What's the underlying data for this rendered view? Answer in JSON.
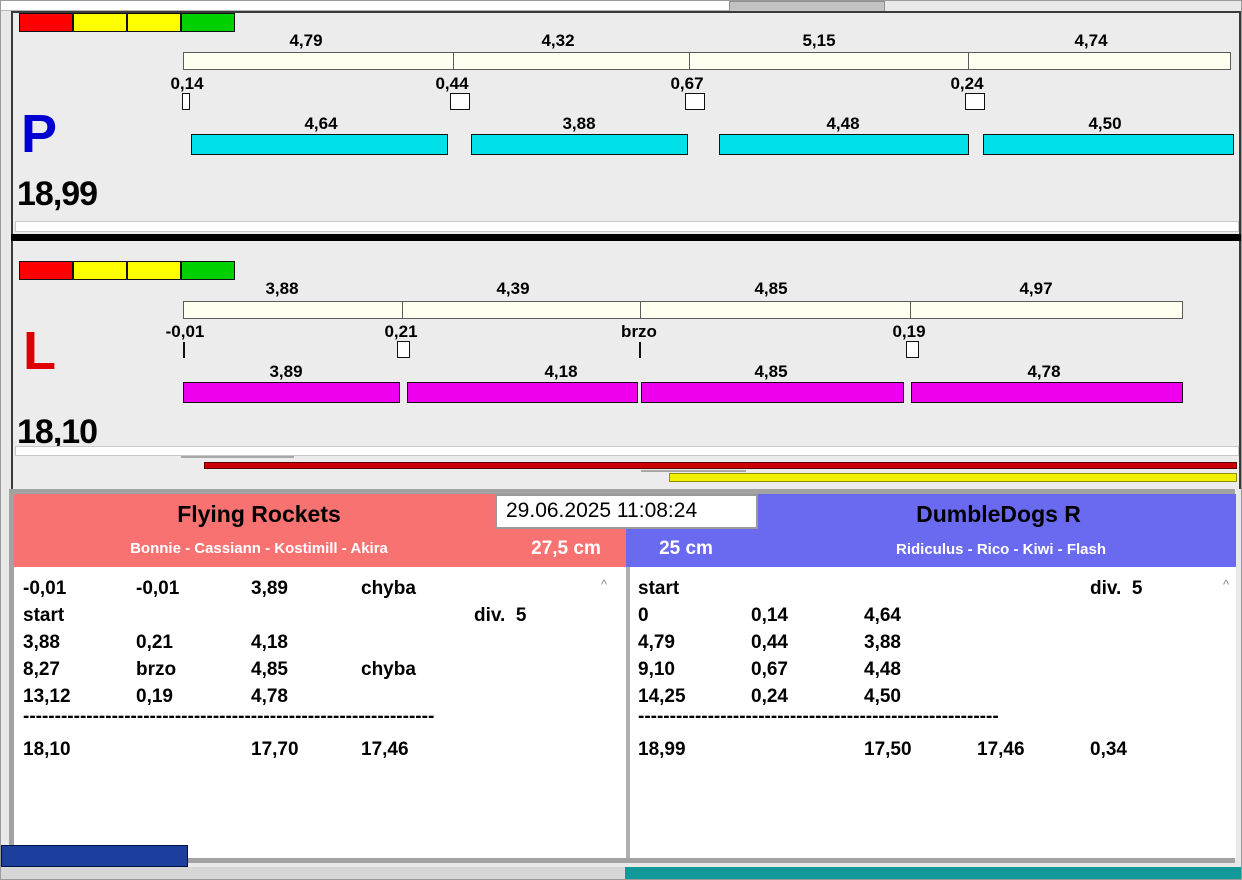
{
  "header": {
    "timestamp": "29.06.2025 11:08:24"
  },
  "colors": {
    "p_letter": "#0000d0",
    "l_letter": "#e00000",
    "p_bar": "#00e0e8",
    "l_bar": "#ee00ee",
    "light_red": "#ff0000",
    "light_yellow": "#ffff00",
    "light_green": "#00d000",
    "left_header": "#f87272",
    "right_header": "#6a6af0",
    "bottom_taskbar": "#129898"
  },
  "lanes": [
    {
      "letter": "P",
      "total": "18,99",
      "splits": [
        "4,79",
        "4,32",
        "5,15",
        "4,74"
      ],
      "changes": [
        "0,14",
        "0,44",
        "0,67",
        "0,24"
      ],
      "legs": [
        "4,64",
        "3,88",
        "4,48",
        "4,50"
      ],
      "lights": [
        "red",
        "yellow",
        "yellow",
        "green"
      ]
    },
    {
      "letter": "L",
      "total": "18,10",
      "splits": [
        "3,88",
        "4,39",
        "4,85",
        "4,97"
      ],
      "changes": [
        "-0,01",
        "0,21",
        "brzo",
        "0,19"
      ],
      "legs": [
        "3,89",
        "4,18",
        "4,85",
        "4,78"
      ],
      "lights": [
        "red",
        "yellow",
        "yellow",
        "green"
      ]
    }
  ],
  "teams": {
    "left": {
      "name": "Flying Rockets",
      "dogs": "Bonnie - Cassiann - Kostimill - Akira",
      "size": "27,5 cm",
      "rows": [
        [
          "-0,01",
          "-0,01",
          "3,89",
          "chyba",
          ""
        ],
        [
          "start",
          "",
          "",
          "",
          "div.  5"
        ],
        [
          "3,88",
          "0,21",
          "4,18",
          "",
          ""
        ],
        [
          "8,27",
          "brzo",
          "4,85",
          "chyba",
          ""
        ],
        [
          "13,12",
          "0,19",
          "4,78",
          "",
          ""
        ]
      ],
      "separator": "-----------------------------------------------------------------",
      "totals": [
        "18,10",
        "",
        "17,70",
        "17,46",
        ""
      ]
    },
    "right": {
      "name": "DumbleDogs R",
      "dogs": "Ridiculus - Rico - Kiwi - Flash",
      "size": "25 cm",
      "rows": [
        [
          "start",
          "",
          "",
          "",
          "div.  5"
        ],
        [
          "0",
          "0,14",
          "4,64",
          "",
          ""
        ],
        [
          "4,79",
          "0,44",
          "3,88",
          "",
          ""
        ],
        [
          "9,10",
          "0,67",
          "4,48",
          "",
          ""
        ],
        [
          "14,25",
          "0,24",
          "4,50",
          "",
          ""
        ]
      ],
      "separator": "---------------------------------------------------------",
      "totals": [
        "18,99",
        "",
        "17,50",
        "17,46",
        "0,34"
      ]
    }
  },
  "scrollbar": {
    "up_arrow": "^"
  }
}
